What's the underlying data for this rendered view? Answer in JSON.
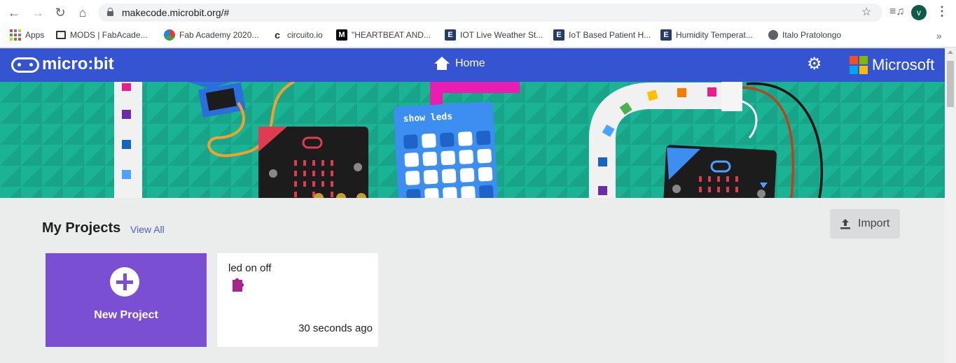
{
  "browser": {
    "url": "makecode.microbit.org/#",
    "avatar_letter": "v",
    "bookmarks": [
      {
        "label": "Apps",
        "icon": "apps-grid-icon"
      },
      {
        "label": "MODS | FabAcade...",
        "icon": "book-icon"
      },
      {
        "label": "Fab Academy 2020...",
        "icon": "fab-academy-icon"
      },
      {
        "label": "circuito.io",
        "icon": "circuito-icon"
      },
      {
        "label": "\"HEARTBEAT AND...",
        "icon": "medium-icon"
      },
      {
        "label": "IOT Live Weather St...",
        "icon": "electronicshub-icon"
      },
      {
        "label": "IoT Based Patient H...",
        "icon": "electronicshub-icon"
      },
      {
        "label": "Humidity Temperat...",
        "icon": "electronicshub-icon"
      },
      {
        "label": "Italo Pratolongo",
        "icon": "globe-icon"
      }
    ]
  },
  "header": {
    "logo_text": "micro:bit",
    "home_label": "Home",
    "microsoft_label": "Microsoft",
    "colors": {
      "header": "#3454d1",
      "ms_red": "#f25022",
      "ms_green": "#7fba00",
      "ms_blue": "#00a4ef",
      "ms_yellow": "#ffb900"
    }
  },
  "banner": {
    "block_label": "show leds",
    "colors": {
      "background": "#1ab394",
      "block": "#3c8ff0",
      "board": "#1c1c1c",
      "pink": "#e91eb0"
    }
  },
  "projects": {
    "title": "My Projects",
    "view_all": "View All",
    "import_label": "Import",
    "new_project_label": "New Project",
    "items": [
      {
        "name": "led on off",
        "time": "30 seconds ago",
        "icon": "puzzle-icon"
      }
    ]
  }
}
